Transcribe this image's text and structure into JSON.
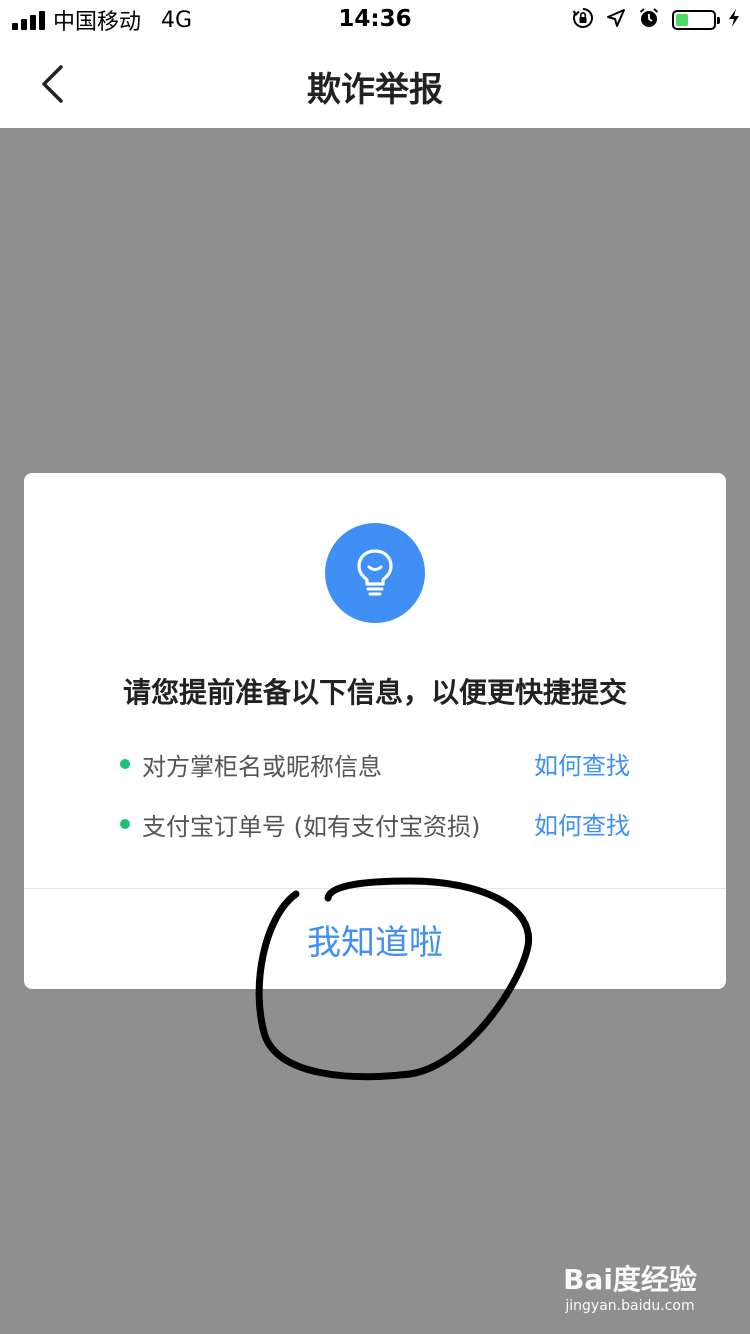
{
  "status_bar": {
    "carrier": "中国移动",
    "network": "4G",
    "time": "14:36",
    "icons": [
      "rotation-lock-icon",
      "location-icon",
      "alarm-icon",
      "battery-icon",
      "charging-icon"
    ],
    "battery_color": "#4cd964"
  },
  "nav": {
    "title": "欺诈举报",
    "back_icon": "chevron-left-icon"
  },
  "dialog": {
    "icon": "lightbulb-icon",
    "icon_bg": "#3f8ff5",
    "title": "请您提前准备以下信息，以便更快捷提交",
    "items": [
      {
        "label": "对方掌柜名或昵称信息",
        "link": "如何查找"
      },
      {
        "label": "支付宝订单号 (如有支付宝资损)",
        "link": "如何查找"
      }
    ],
    "confirm_label": "我知道啦",
    "accent": "#3f8ff5",
    "bullet_color": "#1fc07a"
  },
  "watermark": {
    "logo": "Bai度经验",
    "url": "jingyan.baidu.com"
  }
}
